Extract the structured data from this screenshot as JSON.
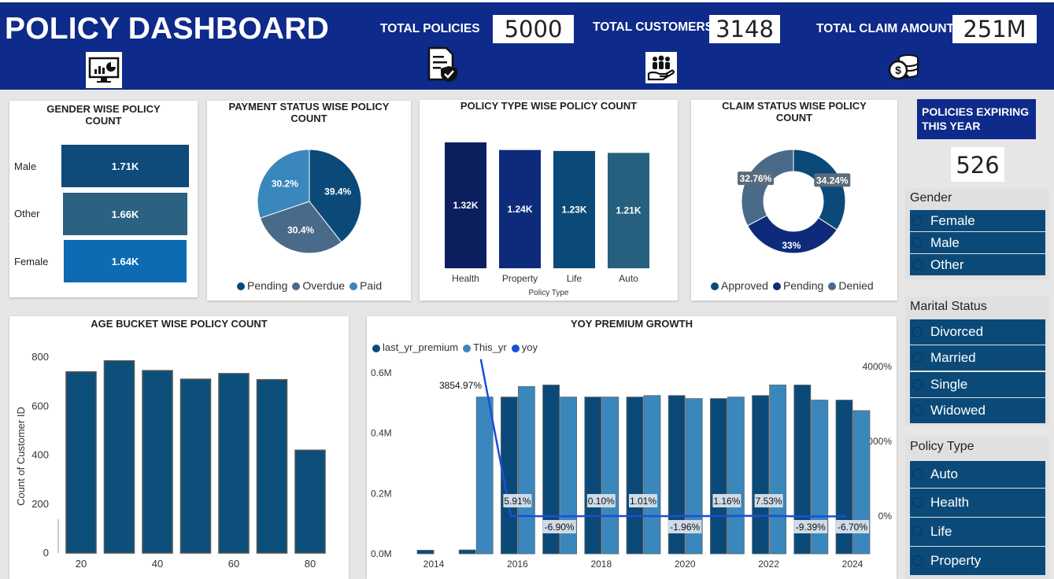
{
  "header": {
    "title": "POLICY DASHBOARD",
    "kpis": [
      {
        "label": "TOTAL POLICIES",
        "value": "5000"
      },
      {
        "label": "TOTAL CUSTOMERS",
        "value": "3148"
      },
      {
        "label": "TOTAL CLAIM AMOUNT",
        "value": "251M"
      }
    ]
  },
  "expiring": {
    "label": "POLICIES EXPIRING THIS YEAR",
    "value": "526"
  },
  "gender_card": {
    "title": "GENDER WISE POLICY COUNT",
    "rows": [
      {
        "label": "Male",
        "value": "1.71K"
      },
      {
        "label": "Other",
        "value": "1.66K"
      },
      {
        "label": "Female",
        "value": "1.64K"
      }
    ]
  },
  "slicers": {
    "gender": {
      "title": "Gender",
      "items": [
        "Female",
        "Male",
        "Other"
      ]
    },
    "marital": {
      "title": "Marital Status",
      "items": [
        "Divorced",
        "Married",
        "Single",
        "Widowed"
      ]
    },
    "policy_type": {
      "title": "Policy Type",
      "items": [
        "Auto",
        "Health",
        "Life",
        "Property"
      ]
    }
  },
  "colors": {
    "navy": "#0e2a8a",
    "dark_blue": "#0b4a78",
    "mid_blue": "#3a87bd",
    "slate": "#4a6a8a"
  },
  "chart_data": [
    {
      "type": "bar",
      "title": "GENDER WISE POLICY COUNT",
      "orientation": "horizontal",
      "categories": [
        "Male",
        "Other",
        "Female"
      ],
      "values": [
        1710,
        1660,
        1640
      ],
      "data_labels": [
        "1.71K",
        "1.66K",
        "1.64K"
      ]
    },
    {
      "type": "pie",
      "title": "PAYMENT STATUS WISE POLICY COUNT",
      "categories": [
        "Pending",
        "Overdue",
        "Paid"
      ],
      "values": [
        39.4,
        30.4,
        30.2
      ],
      "data_labels": [
        "39.4%",
        "30.4%",
        "30.2%"
      ],
      "colors": [
        "#0b4a78",
        "#4a6a8a",
        "#3a87bd"
      ],
      "legend": "bottom"
    },
    {
      "type": "bar",
      "title": "POLICY TYPE WISE POLICY COUNT",
      "xlabel": "Policy Type",
      "categories": [
        "Health",
        "Property",
        "Life",
        "Auto"
      ],
      "values": [
        1320,
        1240,
        1230,
        1210
      ],
      "data_labels": [
        "1.32K",
        "1.24K",
        "1.23K",
        "1.21K"
      ],
      "colors": [
        "#0b1f5e",
        "#0e2a7a",
        "#0b4a78",
        "#27607e"
      ]
    },
    {
      "type": "pie",
      "subtype": "donut",
      "title": "CLAIM STATUS WISE POLICY COUNT",
      "categories": [
        "Approved",
        "Pending",
        "Denied"
      ],
      "values": [
        34.24,
        33,
        32.76
      ],
      "data_labels": [
        "34.24%",
        "33%",
        "32.76%"
      ],
      "colors": [
        "#0b4a78",
        "#0e2a7a",
        "#4a6a8a"
      ],
      "legend": "bottom"
    },
    {
      "type": "bar",
      "title": "AGE BUCKET WISE POLICY COUNT",
      "ylabel": "Count of Customer ID",
      "x": [
        20,
        30,
        40,
        50,
        60,
        70,
        80
      ],
      "values": [
        740,
        785,
        745,
        710,
        733,
        708,
        420
      ],
      "xticks": [
        "20",
        "40",
        "60",
        "80"
      ],
      "yticks": [
        "0",
        "200",
        "400",
        "600",
        "800"
      ],
      "ylim": [
        0,
        850
      ]
    },
    {
      "type": "bar",
      "title": "YOY PREMIUM GROWTH",
      "categories": [
        2014,
        2015,
        2016,
        2017,
        2018,
        2019,
        2020,
        2021,
        2022,
        2023,
        2024
      ],
      "xticks": [
        "2014",
        "2016",
        "2018",
        "2020",
        "2022",
        "2024"
      ],
      "yticks_left": [
        "0.0M",
        "0.2M",
        "0.4M",
        "0.6M"
      ],
      "yticks_right": [
        "0%",
        "2000%",
        "4000%"
      ],
      "ylim": [
        0,
        0.62
      ],
      "y2lim": [
        -700,
        4400
      ],
      "legend": "top-left",
      "series": [
        {
          "name": "last_yr_premium",
          "color": "#0b4a78",
          "values": [
            0.012,
            0.013,
            0.52,
            0.56,
            0.52,
            0.52,
            0.525,
            0.515,
            0.525,
            0.56,
            0.51
          ]
        },
        {
          "name": "This_yr",
          "color": "#3a87bd",
          "values": [
            null,
            0.52,
            0.555,
            0.52,
            0.52,
            0.525,
            0.515,
            0.52,
            0.56,
            0.51,
            0.475
          ]
        },
        {
          "name": "yoy",
          "type": "line",
          "color": "#1a4fd6",
          "values": [
            null,
            4200,
            5.91,
            -6.9,
            0.1,
            1.01,
            -1.96,
            1.16,
            7.53,
            -9.39,
            -6.7
          ],
          "labels": [
            "",
            "3854.97%",
            "5.91%",
            "-6.90%",
            "0.10%",
            "1.01%",
            "-1.96%",
            "1.16%",
            "7.53%",
            "-9.39%",
            "-6.70%"
          ]
        }
      ]
    }
  ]
}
